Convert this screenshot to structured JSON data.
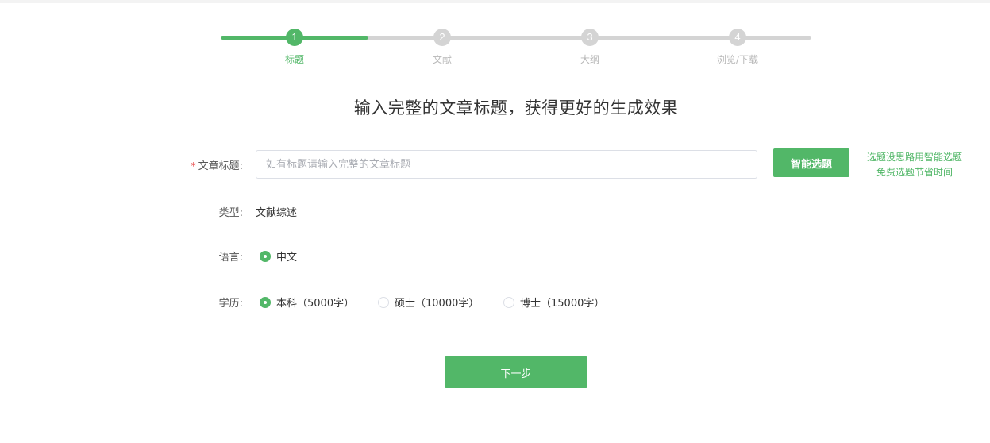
{
  "colors": {
    "accent": "#52b768",
    "required": "#e84a4a",
    "inactive": "#d4d4d4"
  },
  "steps": [
    {
      "num": "1",
      "label": "标题",
      "active": true
    },
    {
      "num": "2",
      "label": "文献",
      "active": false
    },
    {
      "num": "3",
      "label": "大纲",
      "active": false
    },
    {
      "num": "4",
      "label": "浏览/下载",
      "active": false
    }
  ],
  "progress": 0.25,
  "headline": "输入完整的文章标题，获得更好的生成效果",
  "form": {
    "title_label": "文章标题:",
    "title_required_mark": "*",
    "title_placeholder": "如有标题请输入完整的文章标题",
    "title_value": "",
    "smart_button": "智能选题",
    "hint_line1": "选题没思路用智能选题",
    "hint_line2": "免费选题节省时间",
    "type_label": "类型:",
    "type_value": "文献综述",
    "language_label": "语言:",
    "language_options": [
      {
        "label": "中文",
        "checked": true
      }
    ],
    "degree_label": "学历:",
    "degree_options": [
      {
        "label": "本科（5000字）",
        "checked": true
      },
      {
        "label": "硕士（10000字）",
        "checked": false
      },
      {
        "label": "博士（15000字）",
        "checked": false
      }
    ]
  },
  "next_button": "下一步"
}
